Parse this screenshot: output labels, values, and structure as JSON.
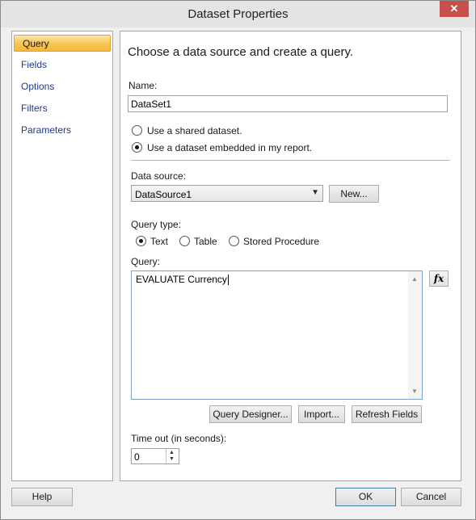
{
  "window": {
    "title": "Dataset Properties",
    "close_glyph": "✕"
  },
  "sidebar": {
    "items": [
      {
        "label": "Query"
      },
      {
        "label": "Fields"
      },
      {
        "label": "Options"
      },
      {
        "label": "Filters"
      },
      {
        "label": "Parameters"
      }
    ]
  },
  "main": {
    "heading": "Choose a data source and create a query.",
    "name_label": "Name:",
    "name_value": "DataSet1",
    "radio_shared": "Use a shared dataset.",
    "radio_embedded": "Use a dataset embedded in my report.",
    "data_source_label": "Data source:",
    "data_source_value": "DataSource1",
    "new_button": "New...",
    "query_type_label": "Query type:",
    "query_type_text": "Text",
    "query_type_table": "Table",
    "query_type_sp": "Stored Procedure",
    "query_label": "Query:",
    "query_text": "EVALUATE Currency",
    "fx_glyph": "fx",
    "query_designer_button": "Query Designer...",
    "import_button": "Import...",
    "refresh_fields_button": "Refresh Fields",
    "timeout_label": "Time out (in seconds):",
    "timeout_value": "0"
  },
  "footer": {
    "help": "Help",
    "ok": "OK",
    "cancel": "Cancel"
  }
}
